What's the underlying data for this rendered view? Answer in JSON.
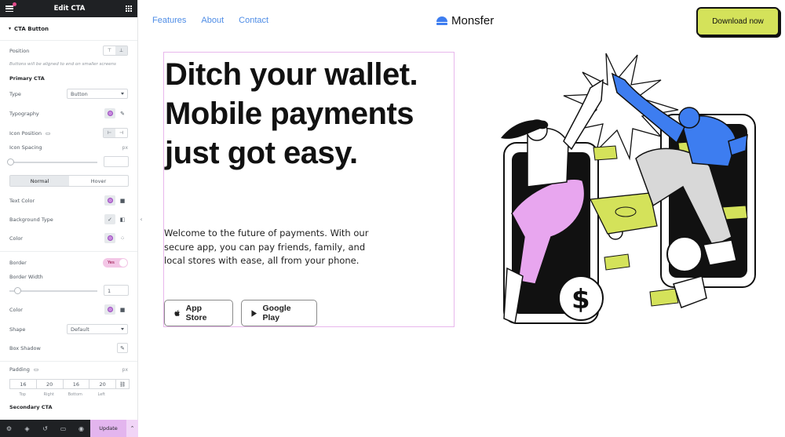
{
  "editor": {
    "header_title": "Edit CTA",
    "section_title": "CTA Button",
    "position_label": "Position",
    "position_note": "Buttons will be aligned to end on smaller screens",
    "primary_cta_label": "Primary CTA",
    "type_label": "Type",
    "type_value": "Button",
    "typography_label": "Typography",
    "icon_position_label": "Icon Position",
    "icon_spacing_label": "Icon Spacing",
    "icon_spacing_unit": "px",
    "state_tabs": [
      "Normal",
      "Hover"
    ],
    "text_color_label": "Text Color",
    "background_type_label": "Background Type",
    "color_label": "Color",
    "border_label": "Border",
    "border_toggle": "Yes",
    "border_width_label": "Border Width",
    "border_width_value": "1",
    "border_color_label": "Color",
    "shape_label": "Shape",
    "shape_value": "Default",
    "box_shadow_label": "Box Shadow",
    "padding_label": "Padding",
    "padding_unit": "px",
    "padding_values": [
      "16",
      "20",
      "16",
      "20"
    ],
    "padding_sides": [
      "Top",
      "Right",
      "Bottom",
      "Left"
    ],
    "secondary_cta_label": "Secondary CTA",
    "update_button": "Update"
  },
  "site": {
    "nav": [
      "Features",
      "About",
      "Contact"
    ],
    "logo": "Monsfer",
    "download_button": "Download now",
    "hero_title": "Ditch your wallet. Mobile payments just got easy.",
    "hero_text": "Welcome to the future of payments. With our secure app, you can pay friends, family, and local stores with ease, all from your phone.",
    "app_store": "App Store",
    "google_play": "Google Play"
  },
  "colors": {
    "accent_yellow": "#d4e25a",
    "link_blue": "#4f8de6",
    "editor_dark": "#1f2124",
    "editor_pink": "#e3b5ee",
    "illus_blue": "#3d7df0",
    "illus_pink": "#e8a6ef"
  }
}
